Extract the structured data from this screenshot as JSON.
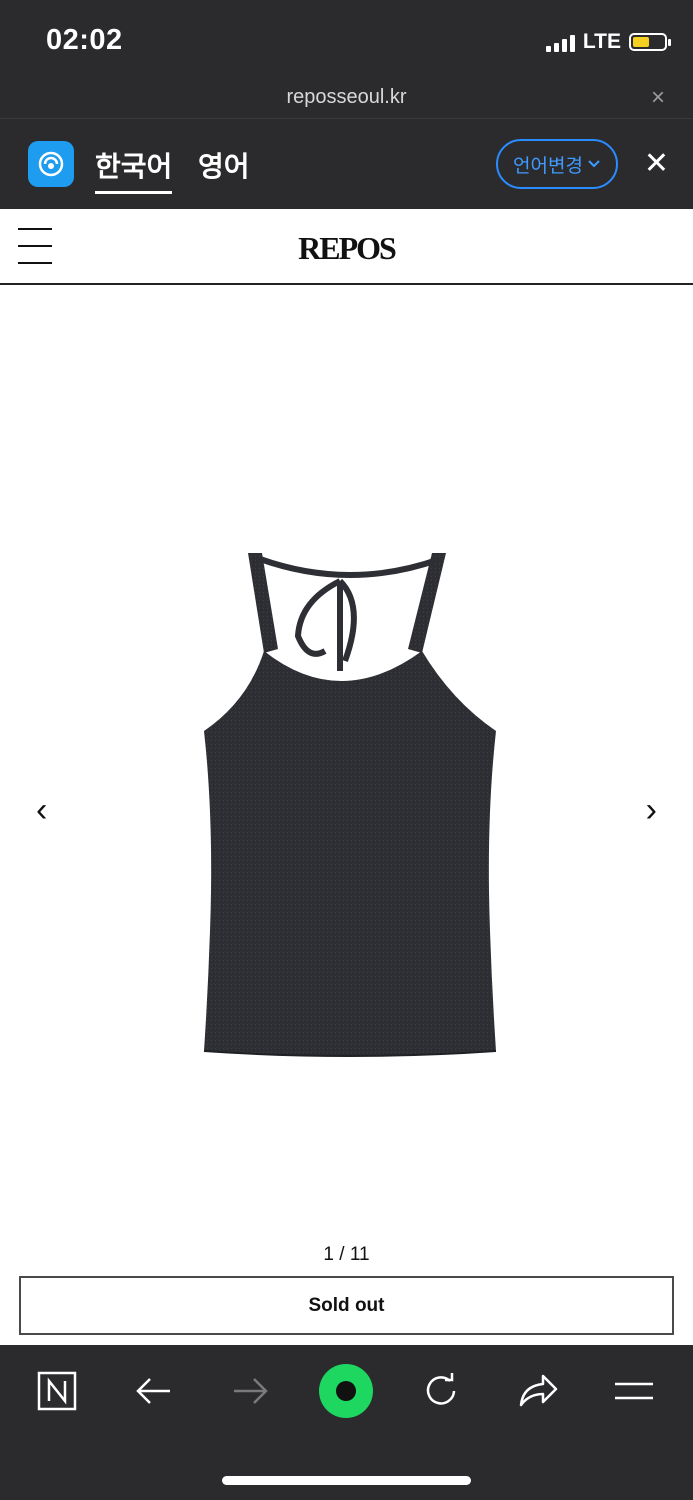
{
  "status_bar": {
    "time": "02:02",
    "network": "LTE"
  },
  "url_bar": {
    "url": "reposseoul.kr",
    "close_glyph": "×"
  },
  "translate_bar": {
    "tabs": [
      {
        "label": "한국어",
        "active": true
      },
      {
        "label": "영어",
        "active": false
      }
    ],
    "change_language_label": "언어변경",
    "close_glyph": "✕",
    "accent_color": "#2a8cff",
    "icon": "papago-icon"
  },
  "site_header": {
    "brand": "REPOS",
    "menu_icon": "hamburger-menu-icon"
  },
  "product": {
    "image_description_icon": "halter-top-image",
    "prev_arrow": "‹",
    "next_arrow": "›",
    "page_counter": "1 / 11",
    "button_label": "Sold out"
  },
  "browser_toolbar": {
    "items": [
      {
        "name": "naver-home-icon"
      },
      {
        "name": "back-icon"
      },
      {
        "name": "forward-icon"
      },
      {
        "name": "green-dot-icon"
      },
      {
        "name": "reload-icon"
      },
      {
        "name": "share-icon"
      },
      {
        "name": "menu-icon"
      }
    ],
    "accent_color": "#1ed760"
  }
}
